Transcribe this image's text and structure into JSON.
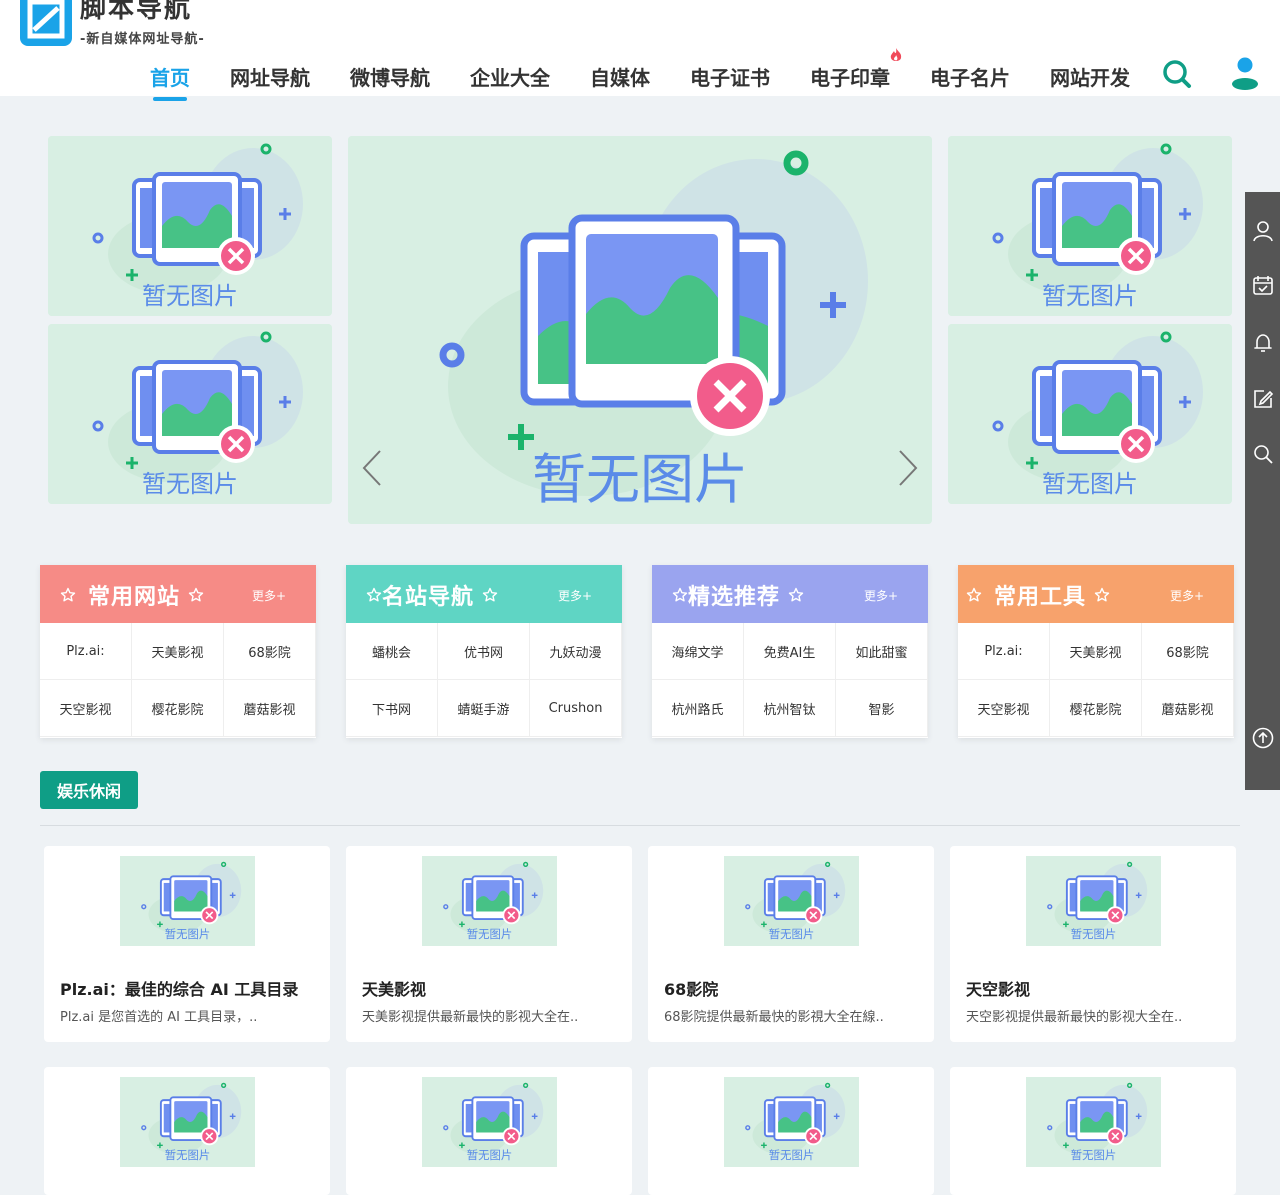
{
  "brand": {
    "title": "脚本导航",
    "subtitle": "-新自媒体网址导航-"
  },
  "nav": {
    "items": [
      "首页",
      "网址导航",
      "微博导航",
      "企业大全",
      "自媒体",
      "电子证书",
      "电子印章",
      "电子名片",
      "网站开发"
    ],
    "active": "首页"
  },
  "placeholder": {
    "text": "暂无图片"
  },
  "categories": [
    {
      "title": "常用网站",
      "more": "更多+",
      "color": "#f68b86",
      "links": [
        "Plz.ai:",
        "天美影视",
        "68影院",
        "天空影视",
        "樱花影院",
        "蘑菇影视"
      ]
    },
    {
      "title": "名站导航",
      "more": "更多+",
      "color": "#5fd5c4",
      "links": [
        "蟠桃会",
        "优书网",
        "九妖动漫",
        "下书网",
        "蜻蜓手游",
        "Crushon"
      ]
    },
    {
      "title": "精选推荐",
      "more": "更多+",
      "color": "#9aa4ef",
      "links": [
        "海绵文学",
        "免费AI生",
        "如此甜蜜",
        "杭州路氏",
        "杭州智钛",
        "智影"
      ]
    },
    {
      "title": "常用工具",
      "more": "更多+",
      "color": "#f7a26c",
      "links": [
        "Plz.ai:",
        "天美影视",
        "68影院",
        "天空影视",
        "樱花影院",
        "蘑菇影视"
      ]
    }
  ],
  "section": {
    "title": "娱乐休闲"
  },
  "sites": [
    {
      "name": "Plz.ai：最佳的综合 AI 工具目录",
      "desc": "Plz.ai 是您首选的 AI 工具目录，.."
    },
    {
      "name": "天美影视",
      "desc": "天美影视提供最新最快的影视大全在.."
    },
    {
      "name": "68影院",
      "desc": "68影院提供最新最快的影視大全在線.."
    },
    {
      "name": "天空影视",
      "desc": "天空影视提供最新最快的影视大全在.."
    }
  ],
  "colors": {
    "accent": "#1aa3e8",
    "section_tag": "#0f9e86",
    "placeholder_bg": "#d8efe3"
  },
  "icons": [
    "search-icon",
    "user-icon",
    "fire-icon",
    "prev-arrow-icon",
    "next-arrow-icon",
    "profile-icon",
    "calendar-icon",
    "bell-icon",
    "edit-icon",
    "search-side-icon",
    "back-to-top-icon",
    "star-icon"
  ]
}
